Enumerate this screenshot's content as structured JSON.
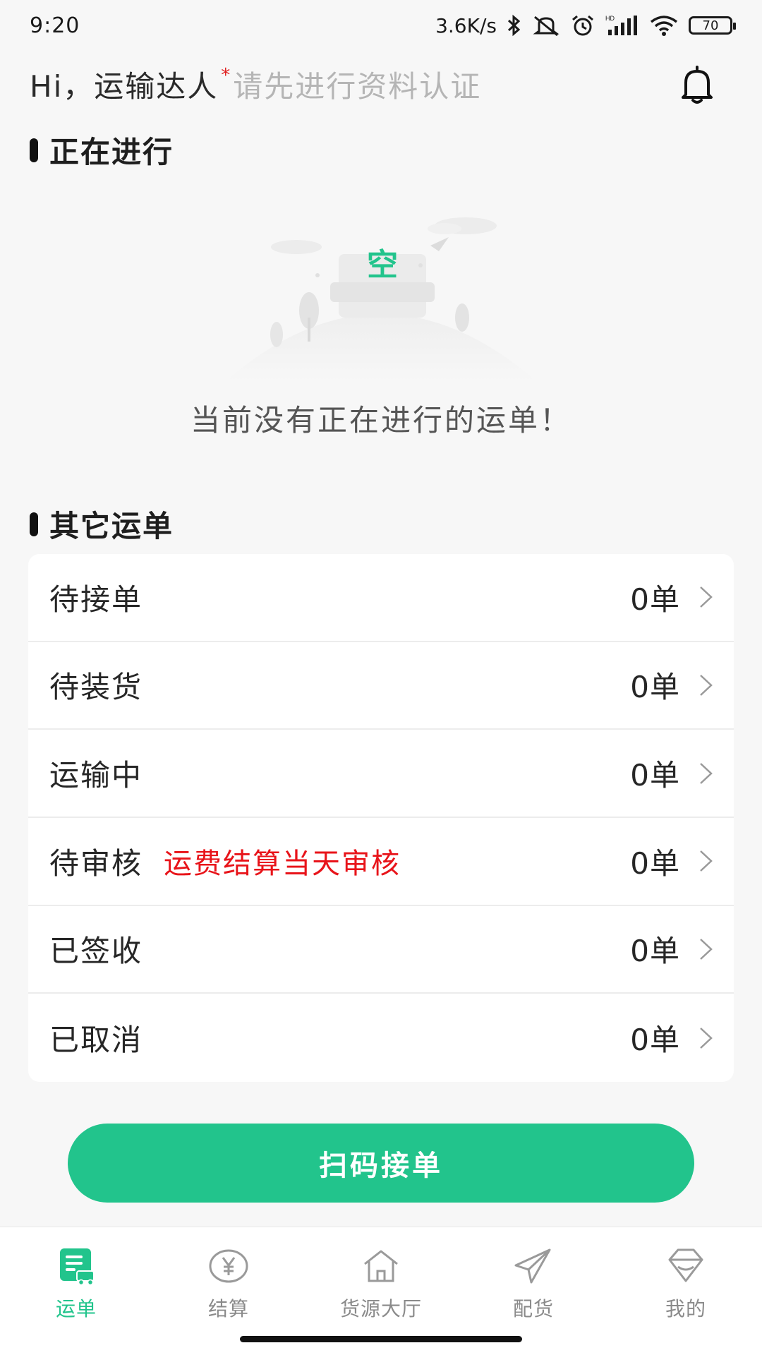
{
  "status_bar": {
    "time": "9:20",
    "network_speed": "3.6K/s",
    "battery": "70",
    "icons": [
      "bluetooth-icon",
      "mute-icon",
      "alarm-icon",
      "hd-signal-icon",
      "wifi-icon",
      "battery-icon"
    ]
  },
  "header": {
    "greeting": "Hi，运输达人",
    "asterisk": "*",
    "verify_hint": "请先进行资料认证",
    "bell_icon": "bell-icon"
  },
  "ongoing": {
    "title": "正在进行",
    "empty_glyph": "空",
    "empty_text": "当前没有正在进行的运单！"
  },
  "other_orders": {
    "title": "其它运单",
    "rows": [
      {
        "label": "待接单",
        "note": "",
        "count": "0单"
      },
      {
        "label": "待装货",
        "note": "",
        "count": "0单"
      },
      {
        "label": "运输中",
        "note": "",
        "count": "0单"
      },
      {
        "label": "待审核",
        "note": "运费结算当天审核",
        "count": "0单"
      },
      {
        "label": "已签收",
        "note": "",
        "count": "0单"
      },
      {
        "label": "已取消",
        "note": "",
        "count": "0单"
      }
    ]
  },
  "scan_button": {
    "label": "扫码接单"
  },
  "bottom_nav": {
    "items": [
      {
        "label": "运单",
        "icon": "waybill-icon",
        "active": true
      },
      {
        "label": "结算",
        "icon": "yen-settlement-icon",
        "active": false
      },
      {
        "label": "货源大厅",
        "icon": "house-icon",
        "active": false
      },
      {
        "label": "配货",
        "icon": "paper-plane-icon",
        "active": false
      },
      {
        "label": "我的",
        "icon": "profile-diamond-icon",
        "active": false
      }
    ]
  },
  "colors": {
    "accent": "#22c48c",
    "warning_text": "#e8141a",
    "hint_gray": "#b5b5b5",
    "background": "#f7f7f7"
  }
}
